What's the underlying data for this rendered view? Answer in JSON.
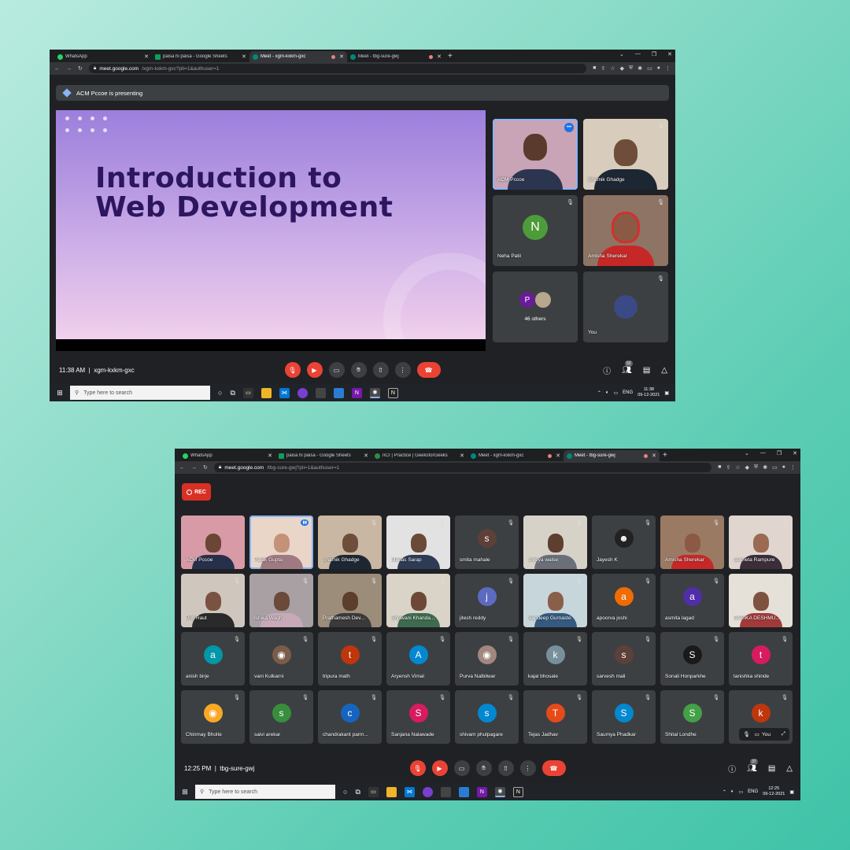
{
  "shot1": {
    "tabs": [
      {
        "label": "WhatsApp",
        "color": "#25d366"
      },
      {
        "label": "paisa hi paisa - Google Sheets",
        "color": "#0f9d58"
      },
      {
        "label": "Meet - xgm-kxkm-gxc",
        "color": "#00897b",
        "recording": true
      },
      {
        "label": "Meet - tbg-sure-gwj",
        "color": "#00897b",
        "recording": true
      }
    ],
    "url_host": "meet.google.com",
    "url_path": "/xgm-kxkm-gxc?pli=1&authuser=1",
    "presenting": "ACM Pccoe is presenting",
    "slide_title": "Introduction to\nWeb Development",
    "participants": [
      {
        "name": "ACM Pccoe"
      },
      {
        "name": "Shamik Ghadge"
      },
      {
        "name": "Neha Patil",
        "initial": "N",
        "color": "#4e9b3a"
      },
      {
        "name": "Amisha Sherekar"
      },
      {
        "name": "46 others",
        "initial": "P",
        "color": "#6a1b9a"
      },
      {
        "name": "You"
      }
    ],
    "time": "11:38 AM",
    "separator": "|",
    "meeting_code": "xgm-kxkm-gxc",
    "people_count": "52",
    "taskbar_search": "Type here to search",
    "tray_lang": "ENG",
    "clock_time": "11:38",
    "clock_date": "09-12-2021"
  },
  "shot2": {
    "tabs": [
      {
        "label": "WhatsApp",
        "color": "#25d366"
      },
      {
        "label": "paisa hi paisa - Google Sheets",
        "color": "#0f9d58"
      },
      {
        "label": "nCr | Practice | GeeksforGeeks",
        "color": "#2f8d46"
      },
      {
        "label": "Meet - xgm-kxkm-gxc",
        "color": "#00897b",
        "recording": true
      },
      {
        "label": "Meet - tbg-sure-gwj",
        "color": "#00897b",
        "recording": true
      }
    ],
    "url_host": "meet.google.com",
    "url_path": "/tbg-sure-gwj?pli=1&authuser=1",
    "rec_label": "REC",
    "participants": [
      {
        "name": "ACM Pccoe",
        "video": true,
        "bg": "#d89aa6",
        "skin": "#6b4535",
        "shirt": "#27304a"
      },
      {
        "name": "Palak Gupta",
        "video": true,
        "bg": "#e9d6c9",
        "skin": "#c49278",
        "shirt": "#a07a82",
        "active": true
      },
      {
        "name": "Shamik Ghadge",
        "video": true,
        "bg": "#c9b7a3",
        "skin": "#6e4e3a",
        "shirt": "#1d2733"
      },
      {
        "name": "Manas Sarap",
        "video": true,
        "bg": "#e2e2e2",
        "skin": "#6a4a37",
        "shirt": "#2d3b55"
      },
      {
        "name": "smita mahale",
        "initial": "s",
        "color": "#5d4037"
      },
      {
        "name": "shreya walse",
        "video": true,
        "bg": "#d7d2c8",
        "skin": "#5e3e2f",
        "shirt": "#6a6f7a"
      },
      {
        "name": "Jayesh K",
        "initial": "☻",
        "color": "#222222"
      },
      {
        "name": "Amisha Sherekar",
        "video": true,
        "bg": "#9b7a63",
        "skin": "#8a5a44",
        "shirt": "#c62828"
      },
      {
        "name": "Sucheta Rampure",
        "video": true,
        "bg": "#e0d6cf",
        "skin": "#9a6a52",
        "shirt": "#3b2e38"
      },
      {
        "name": "Priti Raut",
        "video": true,
        "bg": "#cfc6bd",
        "skin": "#7a5242",
        "shirt": "#2a2a2a"
      },
      {
        "name": "Ishika Wagh",
        "video": true,
        "bg": "#a8a0a2",
        "skin": "#6b4a3a",
        "shirt": "#c7a9b8"
      },
      {
        "name": "Prathamesh Dev...",
        "video": true,
        "bg": "#9c8d7a",
        "skin": "#5b3e2c",
        "shirt": "#3a3a3a"
      },
      {
        "name": "Shravani Khanda...",
        "video": true,
        "bg": "#d9d3c8",
        "skin": "#6d4836",
        "shirt": "#3e6b4e"
      },
      {
        "name": "jitesh reddy",
        "initial": "j",
        "color": "#5c6bc0"
      },
      {
        "name": "Sandeep Gurnaste",
        "video": true,
        "bg": "#c7d6db",
        "skin": "#8a5f4a",
        "shirt": "#355a80"
      },
      {
        "name": "apoorva joshi",
        "initial": "a",
        "color": "#ef6c00"
      },
      {
        "name": "asmita lagad",
        "initial": "a",
        "color": "#512da8"
      },
      {
        "name": "SARIKA DESHMU...",
        "video": true,
        "bg": "#e6e1d8",
        "skin": "#7d5340",
        "shirt": "#a33a3a"
      },
      {
        "name": "anish birje",
        "initial": "a",
        "color": "#0097a7"
      },
      {
        "name": "vani Kulkarni",
        "initial": "◉",
        "color": "#7a5c4a"
      },
      {
        "name": "tripura math",
        "initial": "t",
        "color": "#bf360c"
      },
      {
        "name": "Aryensh Vimal",
        "initial": "A",
        "color": "#0288d1"
      },
      {
        "name": "Purva Nalbilwar",
        "initial": "◉",
        "color": "#a1887f"
      },
      {
        "name": "kajal bhosale",
        "initial": "k",
        "color": "#78909c"
      },
      {
        "name": "sarvesh mali",
        "initial": "s",
        "color": "#5d4037"
      },
      {
        "name": "Sonali Honparkhe",
        "initial": "S",
        "color": "#1a1a1a"
      },
      {
        "name": "tanishka shinde",
        "initial": "t",
        "color": "#d81b60"
      },
      {
        "name": "Chinmay Bholte",
        "initial": "◉",
        "color": "#f9a825"
      },
      {
        "name": "saivi arekar",
        "initial": "s",
        "color": "#388e3c"
      },
      {
        "name": "chandrakant parm...",
        "initial": "c",
        "color": "#1565c0"
      },
      {
        "name": "Sanjana Nalawade",
        "initial": "S",
        "color": "#d81b60"
      },
      {
        "name": "shivam phulpagare",
        "initial": "s",
        "color": "#0288d1"
      },
      {
        "name": "Tejas Jadhav",
        "initial": "T",
        "color": "#e64a19"
      },
      {
        "name": "Saumya Phadkar",
        "initial": "S",
        "color": "#0288d1"
      },
      {
        "name": "Shital Londhe",
        "initial": "S",
        "color": "#43a047"
      },
      {
        "name": "You",
        "initial": "k",
        "color": "#bf360c",
        "self": true
      }
    ],
    "time": "12:25 PM",
    "separator": "|",
    "meeting_code": "tbg-sure-gwj",
    "people_count": "37",
    "taskbar_search": "Type here to search",
    "tray_lang": "ENG",
    "clock_time": "12:25",
    "clock_date": "09-12-2021"
  },
  "colors": {
    "meet_bg": "#202124",
    "tile_bg": "#3c4043",
    "danger": "#ea4335",
    "accent_blue": "#8ab4f8",
    "slide_title": "#2d1660"
  }
}
